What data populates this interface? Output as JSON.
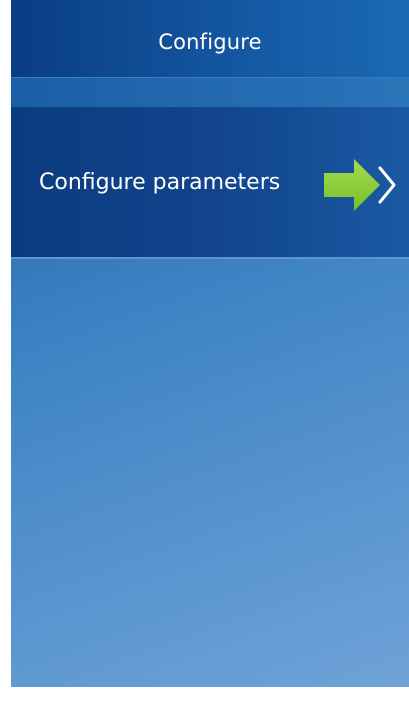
{
  "header": {
    "title": "Configure"
  },
  "menu": {
    "items": [
      {
        "label": "Configure parameters",
        "icon": "chevron-right-icon",
        "highlight_icon": "green-arrow-icon"
      }
    ]
  },
  "colors": {
    "header_bg": "#0a3d83",
    "item_bg": "#0b3c80",
    "panel_gradient_start": "#1f5fa6",
    "panel_gradient_end": "#6fa3d8",
    "arrow": "#8ccf3c",
    "text": "#ffffff"
  }
}
